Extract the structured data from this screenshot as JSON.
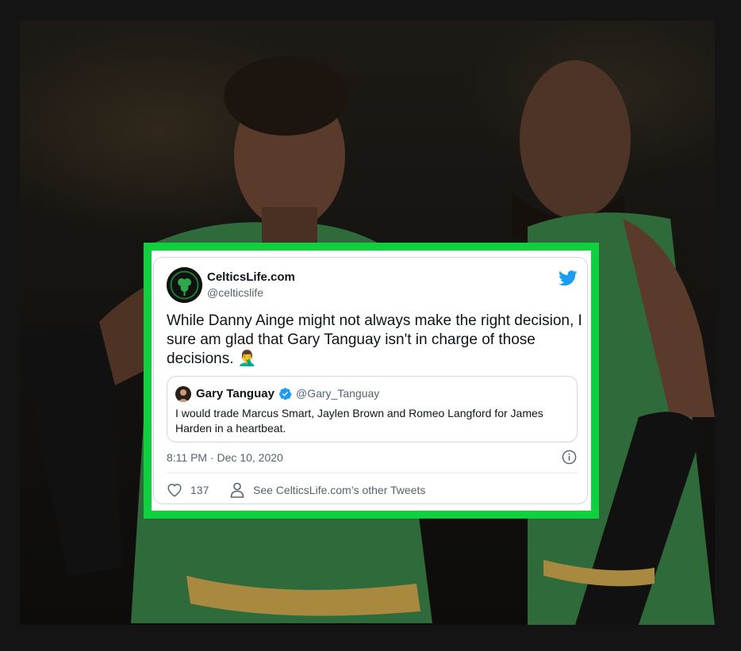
{
  "tweet": {
    "user_name": "CelticsLife.com",
    "user_handle": "@celticslife",
    "text": "While Danny Ainge might not always make the right decision, I sure am glad that Gary Tanguay isn't in charge of those decisions. 🤦‍♂️",
    "quoted": {
      "name": "Gary Tanguay",
      "handle": "@Gary_Tanguay",
      "text": "I would trade Marcus Smart, Jaylen Brown and Romeo Langford for James Harden in a heartbeat."
    },
    "timestamp": "8:11 PM · Dec 10, 2020",
    "likes": "137",
    "others_label": "See CelticsLife.com’s other Tweets"
  },
  "colors": {
    "highlight_border": "#0fd140",
    "twitter_blue": "#1d9bf0",
    "verified_blue": "#1d9bf0",
    "secondary_text": "#536471"
  },
  "icons": [
    "twitter-bird-icon",
    "verified-badge-icon",
    "info-icon",
    "heart-icon",
    "person-icon"
  ]
}
